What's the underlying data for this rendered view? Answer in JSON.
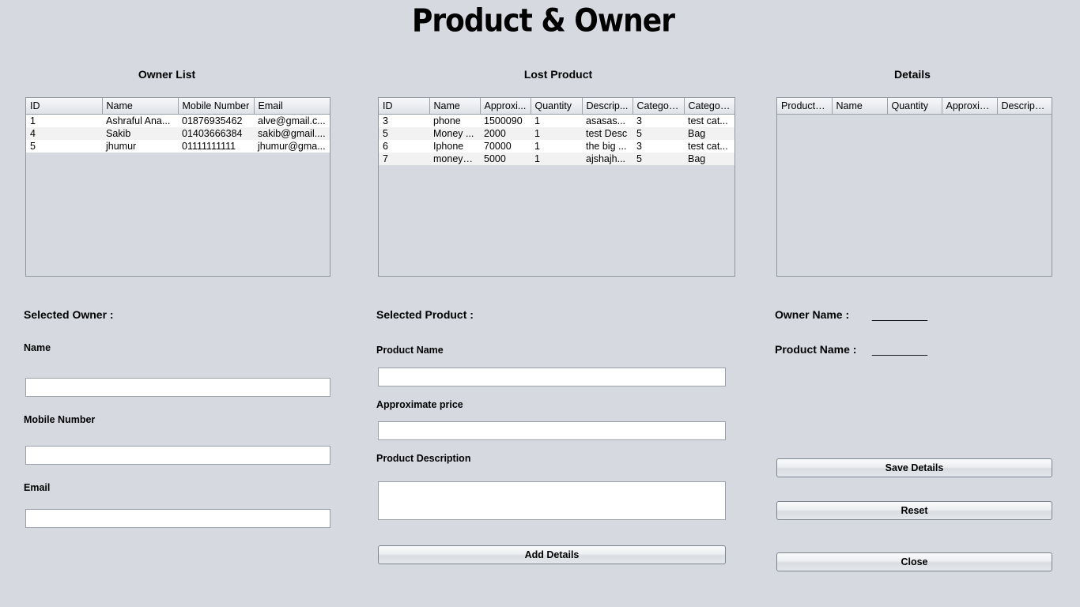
{
  "title": "Product & Owner",
  "owner_list": {
    "heading": "Owner List",
    "columns": [
      "ID",
      "Name",
      "Mobile Number",
      "Email"
    ],
    "rows": [
      [
        "1",
        "Ashraful Ana...",
        "01876935462",
        "alve@gmail.c..."
      ],
      [
        "4",
        "Sakib",
        "01403666384",
        "sakib@gmail...."
      ],
      [
        "5",
        "jhumur",
        "01111111111",
        "jhumur@gma..."
      ]
    ]
  },
  "lost_product": {
    "heading": "Lost Product",
    "columns": [
      "ID",
      "Name",
      "Approxi...",
      "Quantity",
      "Descrip...",
      "Categor...",
      "Categor..."
    ],
    "rows": [
      [
        "3",
        "phone",
        "1500090",
        "1",
        "asasas...",
        "3",
        "test cat..."
      ],
      [
        "5",
        "Money ...",
        "2000",
        "1",
        "test Desc",
        "5",
        "Bag"
      ],
      [
        "6",
        "Iphone",
        "70000",
        "1",
        "the big ...",
        "3",
        "test cat..."
      ],
      [
        "7",
        "moneyb...",
        "5000",
        "1",
        "ajshajh...",
        "5",
        "Bag"
      ]
    ]
  },
  "details": {
    "heading": "Details",
    "columns": [
      "Product ID",
      "Name",
      "Quantity",
      "Approxim...",
      "Descripti..."
    ],
    "rows": []
  },
  "selected_owner": {
    "heading": "Selected Owner :",
    "name_label": "Name",
    "name_value": "",
    "mobile_label": "Mobile Number",
    "mobile_value": "",
    "email_label": "Email",
    "email_value": ""
  },
  "selected_product": {
    "heading": "Selected Product :",
    "name_label": "Product Name",
    "name_value": "",
    "price_label": "Approximate price",
    "price_value": "",
    "desc_label": "Product Description",
    "desc_value": "",
    "add_button": "Add Details"
  },
  "summary": {
    "owner_label": "Owner Name :",
    "owner_value": "_________",
    "product_label": "Product Name :",
    "product_value": "_________"
  },
  "buttons": {
    "save": "Save Details",
    "reset": "Reset",
    "close": "Close"
  }
}
